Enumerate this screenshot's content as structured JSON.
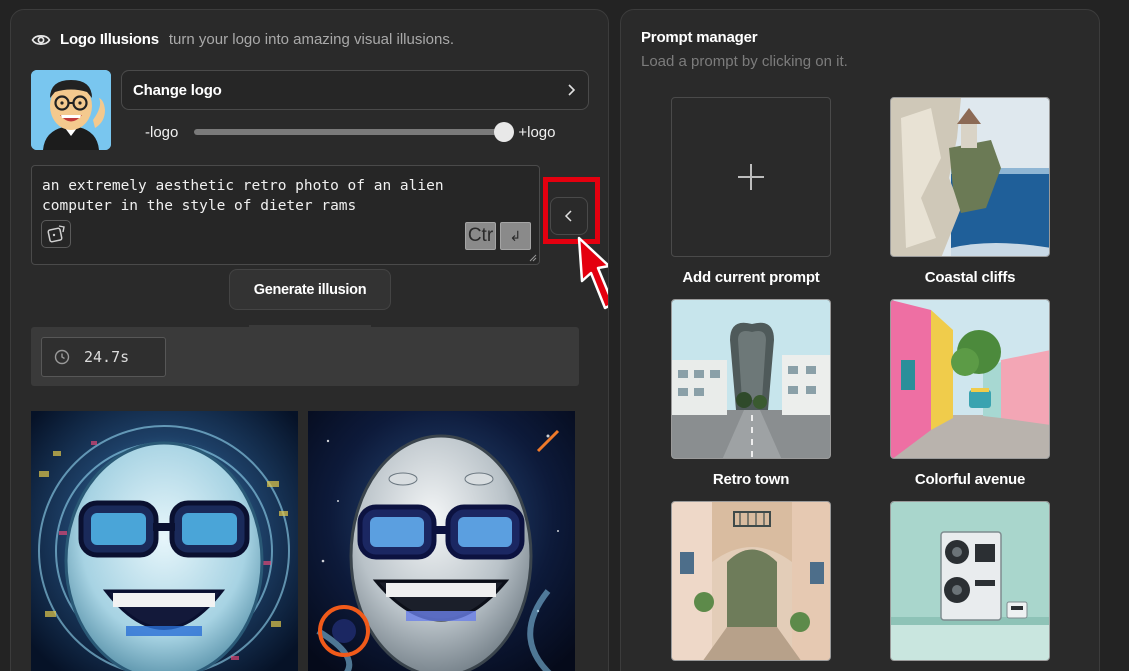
{
  "header": {
    "title": "Logo Illusions",
    "subtitle": "turn your logo into amazing visual illusions."
  },
  "logo": {
    "change_label": "Change logo",
    "slider_min_label": "-logo",
    "slider_max_label": "+logo",
    "slider_value": 1.0
  },
  "prompt": {
    "text": "an extremely aesthetic retro photo of an alien computer in the style of dieter rams",
    "ctrl_key_label": "Ctr",
    "enter_key_label": "↲"
  },
  "generate": {
    "label": "Generate illusion"
  },
  "timer": {
    "value": "24.7s"
  },
  "prompt_manager": {
    "title": "Prompt manager",
    "subtitle": "Load a prompt by clicking on it.",
    "add_label": "Add current prompt",
    "cards": [
      {
        "label": "Coastal cliffs"
      },
      {
        "label": "Retro town"
      },
      {
        "label": "Colorful avenue"
      },
      {
        "label": ""
      },
      {
        "label": ""
      }
    ]
  },
  "colors": {
    "highlight": "#e4000f",
    "panel_bg": "#2a2a2a",
    "page_bg": "#232323"
  }
}
